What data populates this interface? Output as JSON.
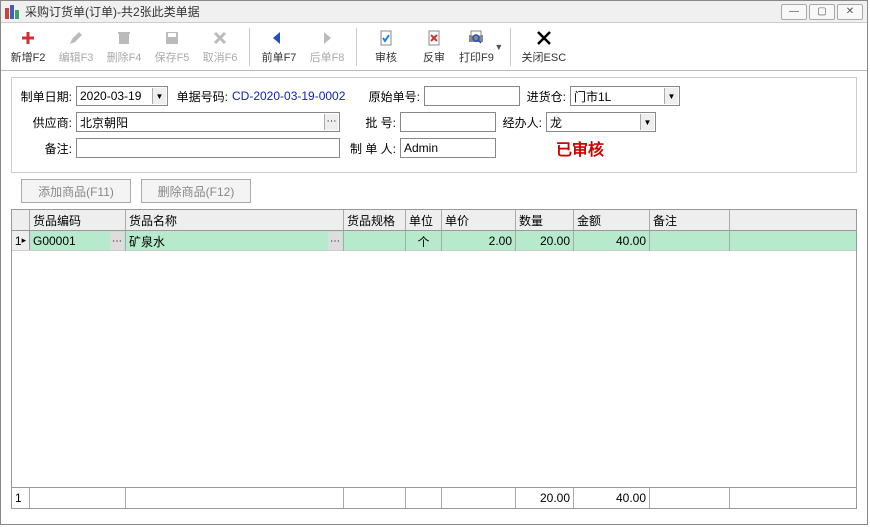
{
  "window": {
    "title": "采购订货单(订单)-共2张此类单据"
  },
  "toolbar": {
    "new": "新增F2",
    "edit": "编辑F3",
    "delete": "删除F4",
    "save": "保存F5",
    "cancel": "取消F6",
    "prev": "前单F7",
    "next": "后单F8",
    "approve": "审核",
    "unapprove": "反审",
    "print": "打印F9",
    "close": "关闭ESC"
  },
  "form": {
    "date_label": "制单日期:",
    "date_value": "2020-03-19",
    "docno_label": "单据号码:",
    "docno_value": "CD-2020-03-19-0002",
    "origno_label": "原始单号:",
    "origno_value": "",
    "warehouse_label": "进货仓:",
    "warehouse_value": "门市1L",
    "supplier_label": "供应商:",
    "supplier_value": "北京朝阳",
    "batch_label": "批    号:",
    "batch_value": "",
    "agent_label": "经办人:",
    "agent_value": "龙",
    "remark_label": "备注:",
    "remark_value": "",
    "maker_label": "制 单 人:",
    "maker_value": "Admin",
    "status_stamp": "已审核"
  },
  "actions": {
    "add_item": "添加商品(F11)",
    "del_item": "删除商品(F12)"
  },
  "grid": {
    "headers": {
      "code": "货品编码",
      "name": "货品名称",
      "spec": "货品规格",
      "unit": "单位",
      "price": "单价",
      "qty": "数量",
      "amt": "金额",
      "note": "备注"
    },
    "rows": [
      {
        "idx": "1",
        "code": "G00001",
        "name": "矿泉水",
        "spec": "",
        "unit": "个",
        "price": "2.00",
        "qty": "20.00",
        "amt": "40.00",
        "note": ""
      }
    ],
    "footer": {
      "idx": "1",
      "qty": "20.00",
      "amt": "40.00"
    }
  }
}
